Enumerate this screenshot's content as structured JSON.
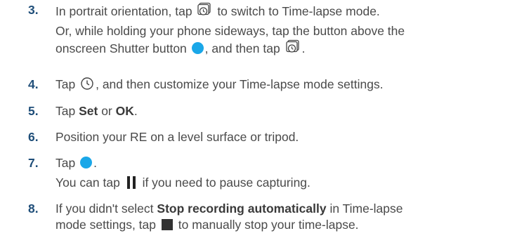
{
  "steps": [
    {
      "number": "3.",
      "line1_a": "In portrait orientation, tap",
      "line1_b": "to switch to Time-lapse mode.",
      "line2": "Or, while holding your phone sideways, tap the button above the",
      "line3_a": "onscreen Shutter button",
      "line3_b": ", and then tap",
      "line3_c": "."
    },
    {
      "number": "4.",
      "text_a": "Tap",
      "text_b": ", and then customize your Time-lapse mode settings."
    },
    {
      "number": "5.",
      "text_a": "Tap",
      "bold_1": "Set",
      "text_b": "or",
      "bold_2": "OK",
      "text_c": "."
    },
    {
      "number": "6.",
      "text": "Position your RE on a level surface or tripod."
    },
    {
      "number": "7.",
      "text_a": "Tap",
      "text_b": ".",
      "line2_a": "You can tap",
      "line2_b": "if you need to pause capturing."
    },
    {
      "number": "8.",
      "line1_a": "If you didn't select",
      "line1_bold": "Stop recording automatically",
      "line1_b": "in Time-lapse",
      "line2_a": "mode settings, tap",
      "line2_b": "to manually stop your time-lapse."
    }
  ],
  "icons": {
    "timelapse": "timelapse-icon",
    "settings": "timer-settings-icon",
    "shutter": "shutter-button-icon",
    "pause": "pause-icon",
    "stop": "stop-icon"
  },
  "colors": {
    "step_number": "#1f4e79",
    "shutter": "#1aa7e8",
    "text": "#4a4a4a"
  }
}
